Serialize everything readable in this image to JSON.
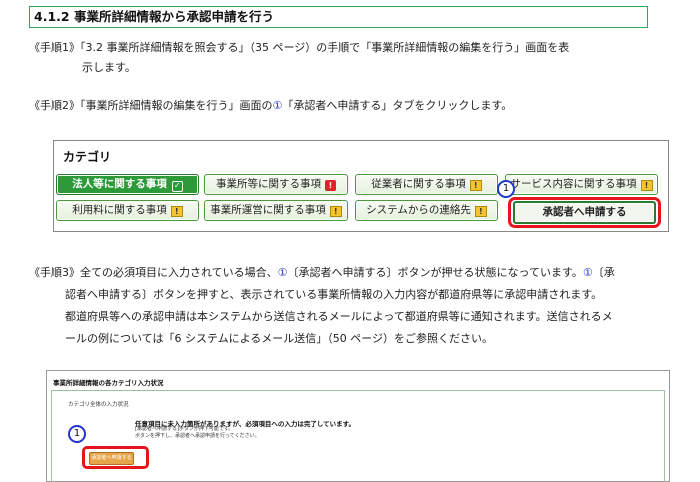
{
  "section": {
    "title": "4.1.2 事業所詳細情報から承認申請を行う"
  },
  "step1": {
    "label": "《手順1》",
    "line1": "「3.2 事業所詳細情報を照会する」（35 ページ）の手順で「事業所詳細情報の編集を行う」画面を表",
    "line2": "示します。"
  },
  "step2": {
    "label": "《手順2》",
    "pre": "「事業所詳細情報の編集を行う」画面の",
    "num": "①",
    "post": "「承認者へ申請する」タブをクリックします。"
  },
  "category": {
    "title": "カテゴリ",
    "tabs": [
      {
        "label": "法人等に関する事項"
      },
      {
        "label": "事業所等に関する事項"
      },
      {
        "label": "従業者に関する事項"
      },
      {
        "label": "サービス内容に関する事項"
      },
      {
        "label": "利用料に関する事項"
      },
      {
        "label": "事業所運営に関する事項"
      },
      {
        "label": "システムからの連絡先"
      },
      {
        "label": "承認者へ申請する"
      }
    ],
    "marker": "1"
  },
  "step3": {
    "label": "《手順3》",
    "seg1": "全ての必須項目に入力されている場合、",
    "num1": "①",
    "seg2": "〔承認者へ申請する〕ボタンが押せる状態になっています。",
    "num2": "①",
    "seg3": "〔承",
    "line2": "認者へ申請する〕ボタンを押すと、表示されている事業所情報の入力内容が都道府県等に承認申請されます。",
    "line3": "都道府県等への承認申請は本システムから送信されるメールによって都道府県等に通知されます。送信されるメ",
    "line4": "ールの例については「6 システムによるメール送信」（50 ページ）をご参照ください。"
  },
  "screenshot": {
    "title": "事業所詳細情報の各カテゴリ入力状況",
    "subtitle": "カテゴリ全体の入力状況",
    "warning": "任意項目に未入力箇所がありますが、必須項目への入力は完了しています。",
    "note1": "[承認者へ申請する]ボタンが押下可能です。",
    "note2": "ボタンを押下し、承認者へ承認申請を行ってください。",
    "button": "承認者へ申請する",
    "marker": "1"
  }
}
